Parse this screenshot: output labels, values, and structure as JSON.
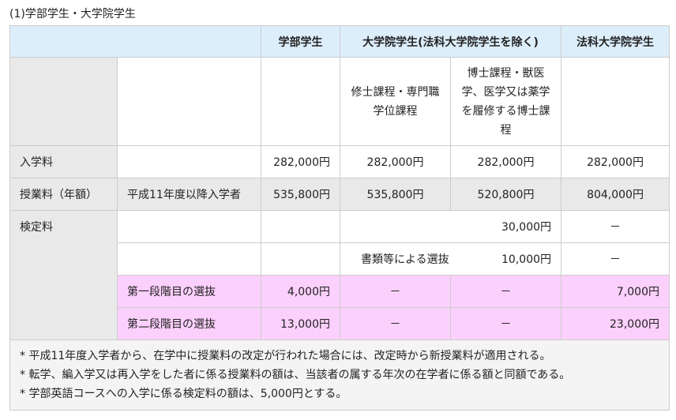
{
  "caption": "(1)学部学生・大学院学生",
  "headers": {
    "undergrad": "学部学生",
    "grad": "大学院学生(法科大学院学生を除く)",
    "law": "法科大学院学生"
  },
  "subheaders": {
    "masters": "修士課程・専門職学位課程",
    "doctoral": "博士課程・獣医学、医学又は薬学を履修する博士課程"
  },
  "rows": {
    "admission": {
      "label": "入学料",
      "undergrad": "282,000円",
      "masters": "282,000円",
      "doctoral": "282,000円",
      "law": "282,000円"
    },
    "tuition": {
      "label": "授業料（年額）",
      "sublabel": "平成11年度以降入学者",
      "undergrad": "535,800円",
      "masters": "535,800円",
      "doctoral": "520,800円",
      "law": "804,000円"
    },
    "exam": {
      "label": "検定料",
      "row1_grad": "30,000円",
      "row1_law": "－",
      "row2_grad_label": "書類等による選抜",
      "row2_grad": "10,000円",
      "row2_law": "－",
      "stage1": {
        "label": "第一段階目の選抜",
        "undergrad": "4,000円",
        "masters": "－",
        "doctoral": "－",
        "law": "7,000円"
      },
      "stage2": {
        "label": "第二段階目の選抜",
        "undergrad": "13,000円",
        "masters": "－",
        "doctoral": "－",
        "law": "23,000円"
      }
    }
  },
  "notes": [
    "* 平成11年度入学者から、在学中に授業料の改定が行われた場合には、改定時から新授業料が適用される。",
    "* 転学、編入学又は再入学をした者に係る授業料の額は、当該者の属する年次の在学者に係る額と同額である。",
    "* 学部英語コースへの入学に係る検定料の額は、5,000円とする。"
  ],
  "colors": {
    "header_bg": "#ddeefb",
    "label_bg": "#e9e9e9",
    "highlight_bg": "#fcd0fc"
  }
}
